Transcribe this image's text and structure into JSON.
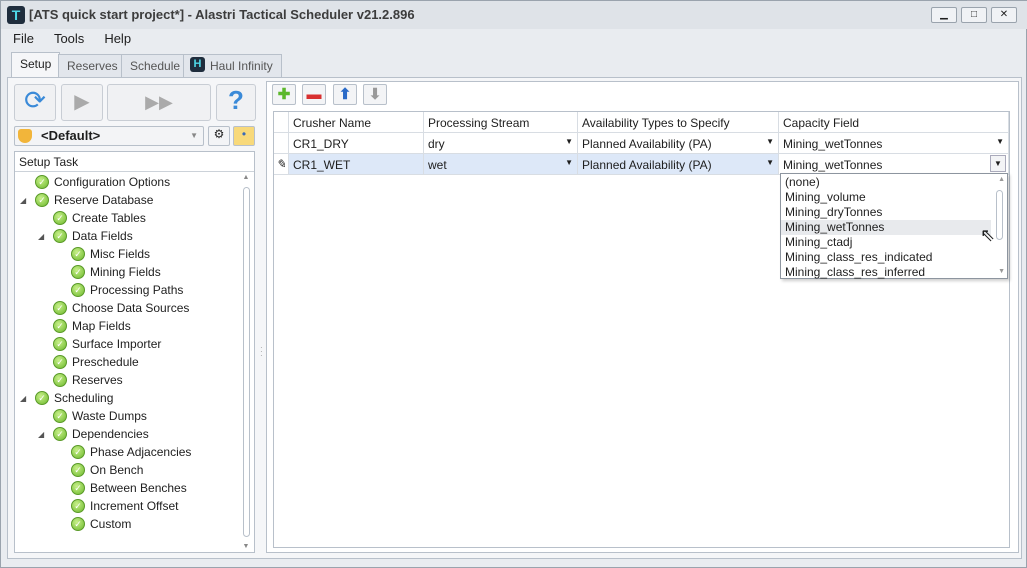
{
  "window": {
    "title": "[ATS quick start project*] - Alastri Tactical Scheduler v21.2.896",
    "logo": "T"
  },
  "menu": [
    "File",
    "Tools",
    "Help"
  ],
  "tabs": [
    "Setup",
    "Reserves",
    "Schedule",
    "Haul Infinity"
  ],
  "profile": {
    "value": "<Default>"
  },
  "tree": {
    "header": "Setup Task",
    "items": [
      {
        "label": "Configuration Options",
        "level": 0
      },
      {
        "label": "Reserve Database",
        "level": 0,
        "expanded": true
      },
      {
        "label": "Create Tables",
        "level": 1
      },
      {
        "label": "Data Fields",
        "level": 1,
        "expanded": true
      },
      {
        "label": "Misc Fields",
        "level": 2
      },
      {
        "label": "Mining Fields",
        "level": 2
      },
      {
        "label": "Processing Paths",
        "level": 2
      },
      {
        "label": "Choose Data Sources",
        "level": 1
      },
      {
        "label": "Map Fields",
        "level": 1
      },
      {
        "label": "Surface Importer",
        "level": 1
      },
      {
        "label": "Preschedule",
        "level": 1
      },
      {
        "label": "Reserves",
        "level": 1
      },
      {
        "label": "Scheduling",
        "level": 0,
        "expanded": true
      },
      {
        "label": "Waste Dumps",
        "level": 1
      },
      {
        "label": "Dependencies",
        "level": 1,
        "expanded": true
      },
      {
        "label": "Phase Adjacencies",
        "level": 2
      },
      {
        "label": "On Bench",
        "level": 2
      },
      {
        "label": "Between Benches",
        "level": 2
      },
      {
        "label": "Increment Offset",
        "level": 2
      },
      {
        "label": "Custom",
        "level": 2
      }
    ]
  },
  "grid": {
    "columns": [
      "Crusher Name",
      "Processing Stream",
      "Availability Types to Specify",
      "Capacity Field"
    ],
    "rows": [
      [
        "CR1_DRY",
        "dry",
        "Planned Availability (PA)",
        "Mining_wetTonnes"
      ],
      [
        "CR1_WET",
        "wet",
        "Planned Availability (PA)",
        "Mining_wetTonnes"
      ]
    ]
  },
  "dropdown": {
    "options": [
      "(none)",
      "Mining_volume",
      "Mining_dryTonnes",
      "Mining_wetTonnes",
      "Mining_ctadj",
      "Mining_class_res_indicated",
      "Mining_class_res_inferred"
    ],
    "hovered": 3
  }
}
